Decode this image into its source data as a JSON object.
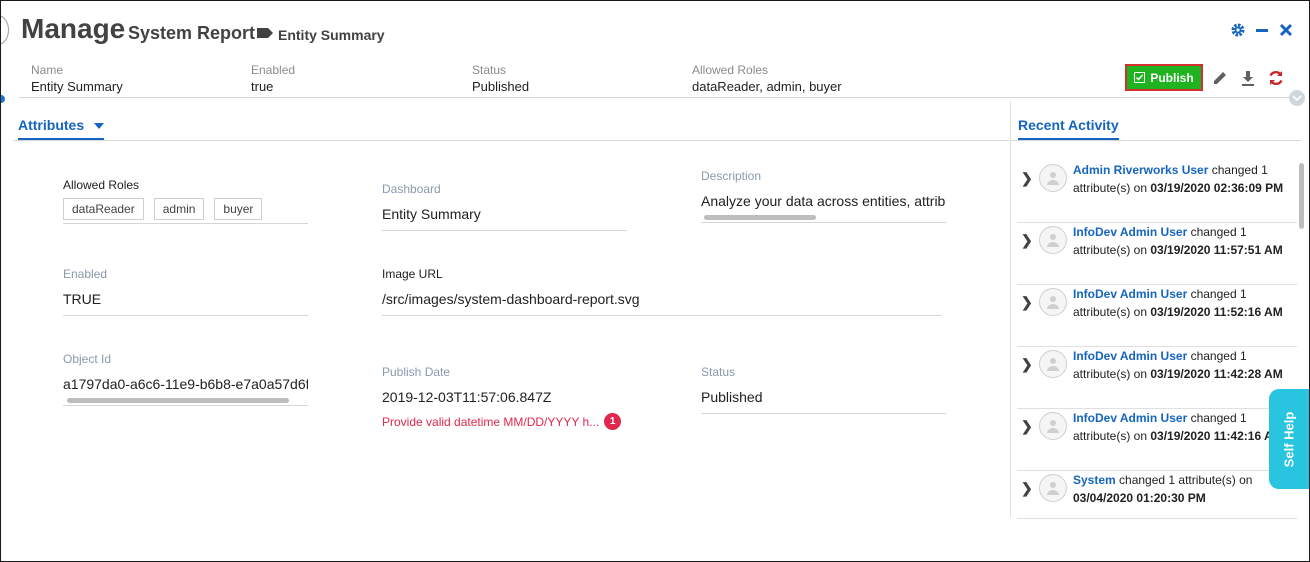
{
  "header": {
    "title": "Manage",
    "subtitle": "System Report",
    "entity_label": "Entity Summary",
    "icons": [
      "gear-icon",
      "minimize-icon",
      "close-icon"
    ]
  },
  "summary": {
    "name_label": "Name",
    "name_value": "Entity Summary",
    "enabled_label": "Enabled",
    "enabled_value": "true",
    "status_label": "Status",
    "status_value": "Published",
    "roles_label": "Allowed Roles",
    "roles_value": "dataReader, admin, buyer"
  },
  "actions": {
    "publish_label": "Publish",
    "icons": [
      "edit-icon",
      "download-icon",
      "refresh-icon"
    ]
  },
  "tabs": {
    "attributes": "Attributes",
    "recent_activity": "Recent Activity"
  },
  "fields": {
    "allowed_roles": {
      "label": "Allowed Roles",
      "chips": [
        "dataReader",
        "admin",
        "buyer"
      ]
    },
    "dashboard": {
      "label": "Dashboard",
      "value": "Entity Summary"
    },
    "description": {
      "label": "Description",
      "value": "Analyze your data across entities, attribu"
    },
    "enabled": {
      "label": "Enabled",
      "value": "TRUE"
    },
    "image_url": {
      "label": "Image URL",
      "value": "/src/images/system-dashboard-report.svg"
    },
    "object_id": {
      "label": "Object Id",
      "value": "a1797da0-a6c6-11e9-b6b8-e7a0a57d6f"
    },
    "publish_date": {
      "label": "Publish Date",
      "value": "2019-12-03T11:57:06.847Z",
      "error": "Provide valid datetime MM/DD/YYYY h...",
      "error_count": "1"
    },
    "status": {
      "label": "Status",
      "value": "Published"
    }
  },
  "activity": [
    {
      "user": "Admin Riverworks User",
      "text": " changed 1 attribute(s) on ",
      "date": "03/19/2020 02:36:09 PM"
    },
    {
      "user": "InfoDev Admin User",
      "text": " changed 1 attribute(s) on ",
      "date": "03/19/2020 11:57:51 AM"
    },
    {
      "user": "InfoDev Admin User",
      "text": " changed 1 attribute(s) on ",
      "date": "03/19/2020 11:52:16 AM"
    },
    {
      "user": "InfoDev Admin User",
      "text": " changed 1 attribute(s) on ",
      "date": "03/19/2020 11:42:28 AM"
    },
    {
      "user": "InfoDev Admin User",
      "text": " changed 1 attribute(s) on ",
      "date": "03/19/2020 11:42:16 AM"
    },
    {
      "user": "System",
      "text": " changed 1 attribute(s) on ",
      "date": "03/04/2020 01:20:30 PM"
    }
  ],
  "self_help": "Self Help",
  "colors": {
    "accent": "#1565c0",
    "publish": "#1fb31f",
    "error": "#e0284f",
    "self_help": "#29c4df"
  }
}
